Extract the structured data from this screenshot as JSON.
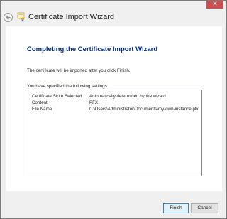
{
  "window": {
    "close_glyph": "✕"
  },
  "header": {
    "title": "Certificate Import Wizard"
  },
  "main": {
    "page_title": "Completing the Certificate Import Wizard",
    "info_text": "The certificate will be imported after you click Finish.",
    "settings_label": "You have specified the following settings:",
    "settings": [
      {
        "key": "Certificate Store Selected",
        "value": "Automatically determined by the wizard"
      },
      {
        "key": "Content",
        "value": "PFX"
      },
      {
        "key": "File Name",
        "value": "C:\\Users\\Administrator\\Documents\\my-own-instance.pfx"
      }
    ]
  },
  "footer": {
    "finish_label": "Finish",
    "cancel_label": "Cancel"
  },
  "colors": {
    "title_blue": "#00297a",
    "close_red": "#c75050",
    "window_bg": "#f0f0f0"
  },
  "icons": {
    "back": "back-arrow-icon",
    "wizard": "certificate-icon",
    "close": "close-icon"
  }
}
